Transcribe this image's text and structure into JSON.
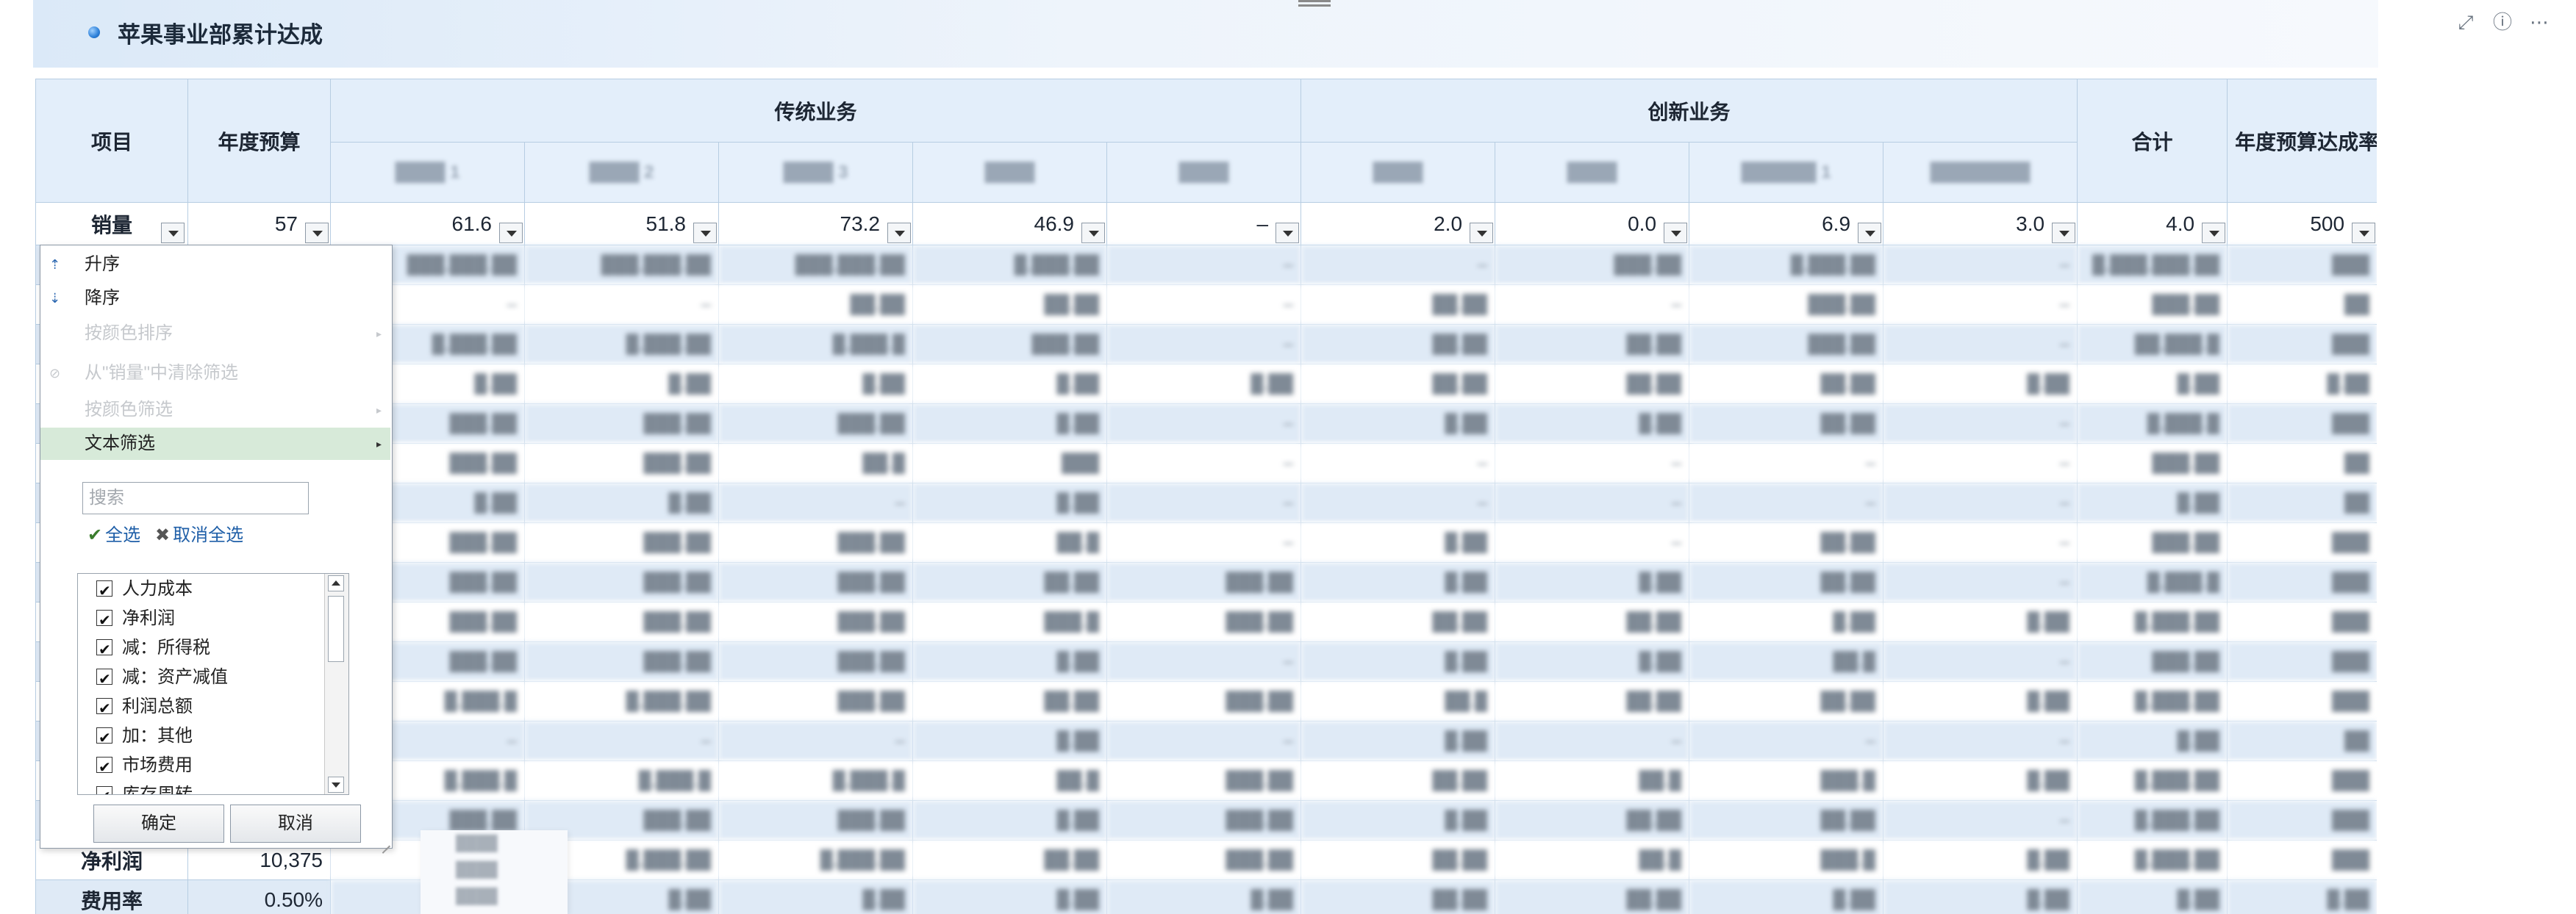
{
  "title": "苹果事业部累计达成",
  "toolbar": {
    "expand_icon": "expand-icon",
    "info_icon": "info-icon",
    "more_icon": "more-icon"
  },
  "table": {
    "headers": {
      "item": "项目",
      "annual_budget": "年度预算",
      "group_traditional": "传统业务",
      "group_innovation": "创新业务",
      "total": "合计",
      "annual_rate": "年度预算达成率"
    },
    "sub_headers": [
      "████ 1",
      "████ 2",
      "████ 3",
      "████",
      "████",
      "████",
      "████",
      "██████ 1",
      "████████"
    ],
    "first_row": {
      "label": "销量",
      "values": [
        "57",
        "61.6",
        "51.8",
        "73.2",
        "46.9",
        "–",
        "2.0",
        "0.0",
        "6.9",
        "3.0",
        "4.0",
        "500"
      ]
    },
    "bottom_rows": [
      {
        "label": "净利润",
        "budget": "10,375"
      },
      {
        "label": "费用率",
        "budget": "0.50%"
      }
    ],
    "blurred_rows": [
      [
        "███,███.██",
        "███,███.██",
        "███,███.██",
        "█,███.██",
        "–",
        "–",
        "███.██",
        "█,███.██",
        "–",
        "█,███,███.██",
        "███"
      ],
      [
        "–",
        "–",
        "██.██",
        "██.██",
        "–",
        "██.██",
        "–",
        "███.██",
        "–",
        "███.██",
        "██"
      ],
      [
        "█,███.██",
        "█,███.██",
        "█,███.█",
        "███.██",
        "–",
        "██.██",
        "██.██",
        "███.██",
        "–",
        "██,███.█",
        "███"
      ],
      [
        "█.██",
        "█.██",
        "█.██",
        "█.██",
        "█.██",
        "██.██",
        "██.██",
        "██.██",
        "█.██",
        "█.██",
        "█.██"
      ],
      [
        "███.██",
        "███.██",
        "███.██",
        "█.██",
        "–",
        "█.██",
        "█.██",
        "██.██",
        "–",
        "█,███.█",
        "███"
      ],
      [
        "███.██",
        "███.██",
        "██.█",
        "███",
        "–",
        "–",
        "–",
        "–",
        "–",
        "███.██",
        "██"
      ],
      [
        "█.██",
        "█.██",
        "–",
        "█.██",
        "–",
        "–",
        "–",
        "–",
        "–",
        "█.██",
        "██"
      ],
      [
        "███.██",
        "███.██",
        "███.██",
        "██.█",
        "–",
        "█.██",
        "–",
        "██.██",
        "–",
        "███.██",
        "███"
      ],
      [
        "███.██",
        "███.██",
        "███.██",
        "██.██",
        "███.██",
        "█.██",
        "█.██",
        "██.██",
        "–",
        "█,███.█",
        "███"
      ],
      [
        "███.██",
        "███.██",
        "███.██",
        "███.█",
        "███.██",
        "██.██",
        "██.██",
        "█.██",
        "█.██",
        "█,███.██",
        "███"
      ],
      [
        "███.██",
        "███.██",
        "███.██",
        "█.██",
        "–",
        "█.██",
        "█.██",
        "██.█",
        "–",
        "███.██",
        "███"
      ],
      [
        "█,███.█",
        "█,███.██",
        "███.██",
        "██.██",
        "███.██",
        "██.█",
        "██.██",
        "██.██",
        "█.██",
        "█,███.██",
        "███"
      ],
      [
        "–",
        "–",
        "–",
        "█.██",
        "–",
        "█.██",
        "–",
        "–",
        "–",
        "█.██",
        "██"
      ],
      [
        "█,███.█",
        "█,███.█",
        "█,███.█",
        "██.█",
        "███.██",
        "██.██",
        "██.█",
        "███.█",
        "█.██",
        "█,███.██",
        "███"
      ],
      [
        "███.██",
        "███.██",
        "███.██",
        "█.██",
        "███.██",
        "█.██",
        "██.██",
        "██.██",
        "–",
        "█,███.██",
        "███"
      ],
      [
        "█,███.██",
        "█,███.██",
        "█,███.██",
        "██.██",
        "███.██",
        "██.██",
        "██.█",
        "███.█",
        "█.██",
        "█,███.██",
        "███"
      ],
      [
        "█.██",
        "█.██",
        "█.██",
        "█.██",
        "█.██",
        "██.██",
        "██.██",
        "█.██",
        "█.██",
        "█.██",
        "█.██"
      ]
    ]
  },
  "filter_popup": {
    "menu": [
      {
        "label": "升序",
        "icon": "sort-ascending-icon",
        "disabled": false
      },
      {
        "label": "降序",
        "icon": "sort-descending-icon",
        "disabled": false
      },
      {
        "label": "按颜色排序",
        "icon": "",
        "disabled": true,
        "submenu": true
      },
      {
        "label": "从\"销量\"中清除筛选",
        "icon": "clear-filter-icon",
        "disabled": true
      },
      {
        "label": "按颜色筛选",
        "icon": "",
        "disabled": true,
        "submenu": true
      },
      {
        "label": "文本筛选",
        "icon": "",
        "disabled": false,
        "submenu": true,
        "highlighted": true
      }
    ],
    "search_placeholder": "搜索",
    "select_all": "全选",
    "deselect_all": "取消全选",
    "list": [
      {
        "label": "人力成本",
        "checked": true
      },
      {
        "label": "净利润",
        "checked": true
      },
      {
        "label": "减：所得税",
        "checked": true
      },
      {
        "label": "减：资产减值",
        "checked": true
      },
      {
        "label": "利润总额",
        "checked": true
      },
      {
        "label": "加：其他",
        "checked": true
      },
      {
        "label": "市场费用",
        "checked": true
      },
      {
        "label": "库存周转",
        "checked": true
      }
    ],
    "ok": "确定",
    "cancel": "取消"
  },
  "ghost_popup_items": [
    "████",
    "████",
    "████"
  ]
}
